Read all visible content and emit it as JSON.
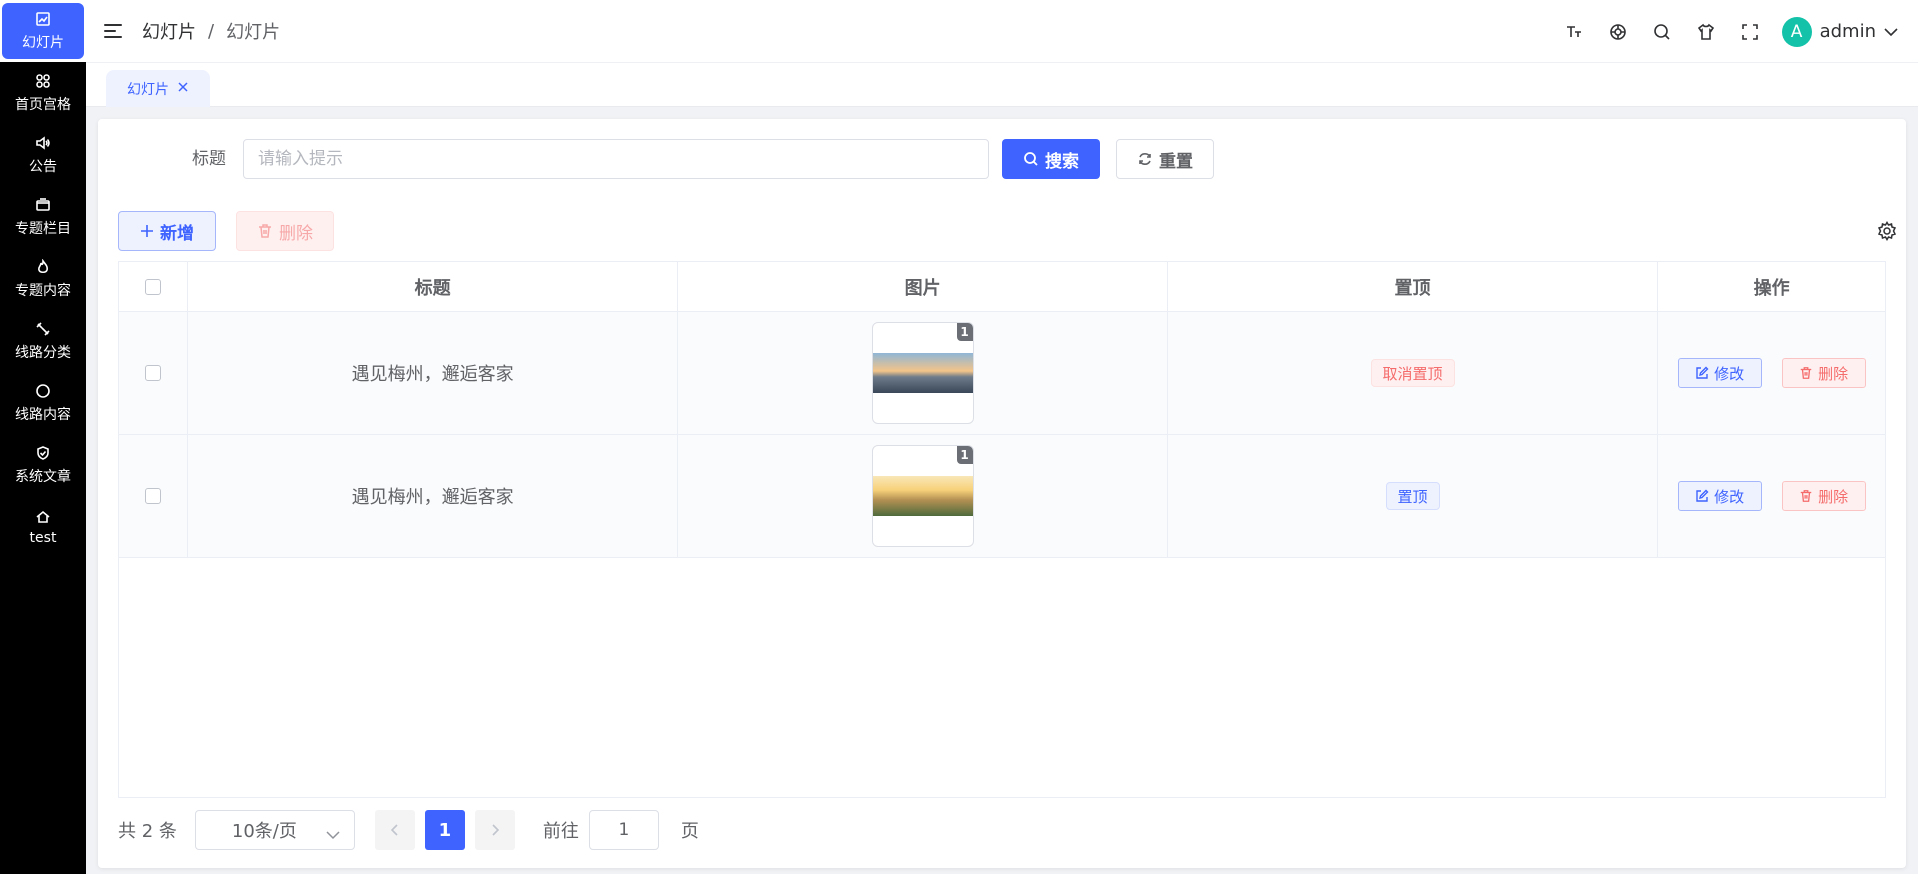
{
  "sidebar": {
    "items": [
      {
        "label": "幻灯片",
        "icon": "image-icon",
        "active": true
      },
      {
        "label": "首页宫格",
        "icon": "grid-icon"
      },
      {
        "label": "公告",
        "icon": "speaker-icon"
      },
      {
        "label": "专题栏目",
        "icon": "folder-icon"
      },
      {
        "label": "专题内容",
        "icon": "flame-icon"
      },
      {
        "label": "线路分类",
        "icon": "tool-icon"
      },
      {
        "label": "线路内容",
        "icon": "circle-icon"
      },
      {
        "label": "系统文章",
        "icon": "shield-check-icon"
      },
      {
        "label": "test",
        "icon": "home-icon"
      }
    ]
  },
  "header": {
    "breadcrumb": [
      "幻灯片",
      "幻灯片"
    ],
    "breadcrumb_sep": "/",
    "user": {
      "avatar_letter": "A",
      "name": "admin",
      "avatar_color": "#13c2a8"
    },
    "icons": [
      "font-size-icon",
      "github-icon",
      "search-icon",
      "tshirt-icon",
      "fullscreen-icon"
    ]
  },
  "tabs": [
    {
      "label": "幻灯片",
      "active": true
    }
  ],
  "search": {
    "label": "标题",
    "placeholder": "请输入提示",
    "value": "",
    "search_label": "搜索",
    "reset_label": "重置"
  },
  "toolbar": {
    "add_label": "新增",
    "delete_label": "删除"
  },
  "table": {
    "columns": [
      "标题",
      "图片",
      "置顶",
      "操作"
    ],
    "rows": [
      {
        "title": "遇见梅州，邂逅客家",
        "img_count": "1",
        "top_label": "取消置顶",
        "top_state": "pinned"
      },
      {
        "title": "遇见梅州，邂逅客家",
        "img_count": "1",
        "top_label": "置顶",
        "top_state": "unpinned"
      }
    ],
    "edit_label": "修改",
    "delete_label": "删除"
  },
  "pagination": {
    "total_text": "共 2 条",
    "page_size": "10条/页",
    "current_page": "1",
    "goto_label": "前往",
    "goto_value": "1",
    "page_unit": "页"
  },
  "colors": {
    "primary": "#3e63ff",
    "danger": "#f56c6c",
    "sidebar_bg": "#000000"
  }
}
